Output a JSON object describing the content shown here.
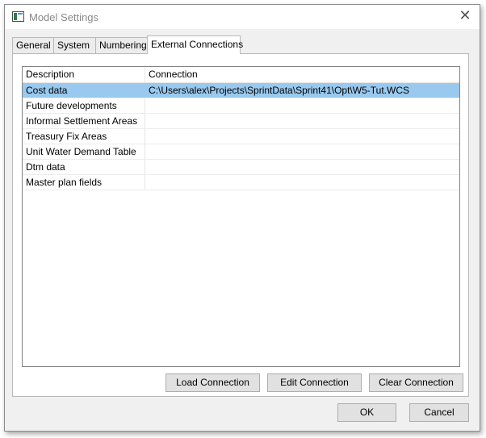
{
  "window": {
    "title": "Model Settings"
  },
  "tabs": [
    {
      "label": "General",
      "active": false
    },
    {
      "label": "System",
      "active": false
    },
    {
      "label": "Numbering",
      "active": false
    },
    {
      "label": "External Connections",
      "active": true
    }
  ],
  "grid": {
    "columns": [
      "Description",
      "Connection"
    ],
    "rows": [
      {
        "description": "Cost data",
        "connection": "C:\\Users\\alex\\Projects\\SprintData\\Sprint41\\Opt\\W5-Tut.WCS",
        "selected": true
      },
      {
        "description": "Future developments",
        "connection": ""
      },
      {
        "description": "Informal Settlement Areas",
        "connection": ""
      },
      {
        "description": "Treasury Fix Areas",
        "connection": ""
      },
      {
        "description": "Unit Water Demand Table",
        "connection": ""
      },
      {
        "description": "Dtm data",
        "connection": ""
      },
      {
        "description": "Master plan fields",
        "connection": ""
      }
    ]
  },
  "actions": {
    "load": "Load Connection",
    "edit": "Edit Connection",
    "clear": "Clear Connection"
  },
  "footer": {
    "ok": "OK",
    "cancel": "Cancel"
  },
  "colors": {
    "selection": "#99c9ef",
    "window_bg": "#f0f0f0",
    "button_bg": "#e1e1e1"
  },
  "icons": {
    "app": "model-settings-app-icon",
    "close": "close-icon"
  }
}
